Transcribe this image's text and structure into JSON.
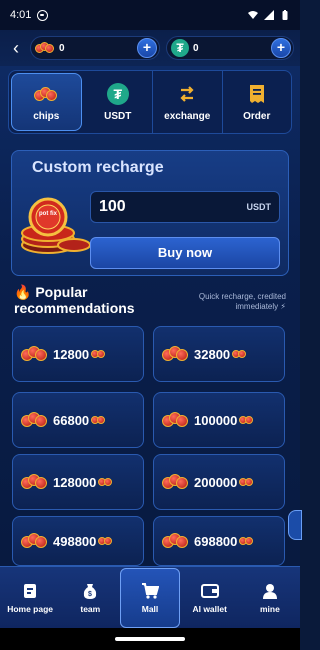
{
  "status": {
    "time": "4:01"
  },
  "topbar": {
    "chips_balance": "0",
    "usdt_balance": "0"
  },
  "tabs": [
    {
      "label": "chips",
      "icon": "chips-icon"
    },
    {
      "label": "USDT",
      "icon": "tether-icon"
    },
    {
      "label": "exchange",
      "icon": "exchange-icon"
    },
    {
      "label": "Order",
      "icon": "receipt-icon"
    }
  ],
  "recharge": {
    "title": "Custom recharge",
    "amount": "100",
    "unit": "USDT",
    "buy_label": "Buy now",
    "chip_brand": "pot fix"
  },
  "popular": {
    "title": "Popular recommendations",
    "note": "Quick recharge, credited immediately ⚡"
  },
  "packages": [
    "12800",
    "32800",
    "66800",
    "100000",
    "128000",
    "200000",
    "498800",
    "698800"
  ],
  "nav": [
    {
      "label": "Home page",
      "icon": "home-icon"
    },
    {
      "label": "team",
      "icon": "team-icon"
    },
    {
      "label": "Mall",
      "icon": "cart-icon"
    },
    {
      "label": "AI wallet",
      "icon": "wallet-icon"
    },
    {
      "label": "mine",
      "icon": "user-icon"
    }
  ],
  "colors": {
    "accent": "#2c63d0",
    "background": "#0a1f4c",
    "tether": "#1fa88a",
    "chip_red": "#c8261a",
    "chip_gold": "#f0b030"
  }
}
